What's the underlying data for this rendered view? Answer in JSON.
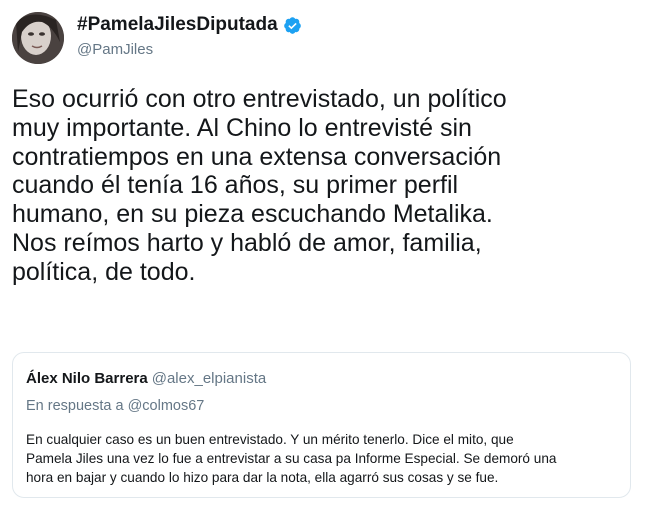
{
  "tweet": {
    "display_name": "#PamelaJilesDiputada",
    "handle": "@PamJiles",
    "verified_icon": "verified-badge-icon",
    "text": "Eso ocurrió con otro entrevistado, un político\nmuy importante. Al Chino lo entrevisté sin\ncontratiempos en una extensa conversación\ncuando él tenía 16 años, su primer perfil\nhumano, en su pieza escuchando Metalika.\nNos reímos harto y habló de amor, familia,\npolítica, de todo."
  },
  "quoted_tweet": {
    "name": "Álex Nilo Barrera",
    "handle": "@alex_elpianista",
    "reply_to": "En respuesta a @colmos67",
    "text": "En cualquier caso es un buen entrevistado. Y un mérito tenerlo. Dice el mito, que\nPamela Jiles una vez lo fue a entrevistar a su casa pa Informe Especial. Se demoró una\nhora en bajar y cuando lo hizo para dar la nota, ella agarró sus cosas y se fue."
  },
  "colors": {
    "verified": "#1da1f2",
    "secondary_text": "#657786",
    "primary_text": "#14171a",
    "border": "#e1e8ed"
  }
}
